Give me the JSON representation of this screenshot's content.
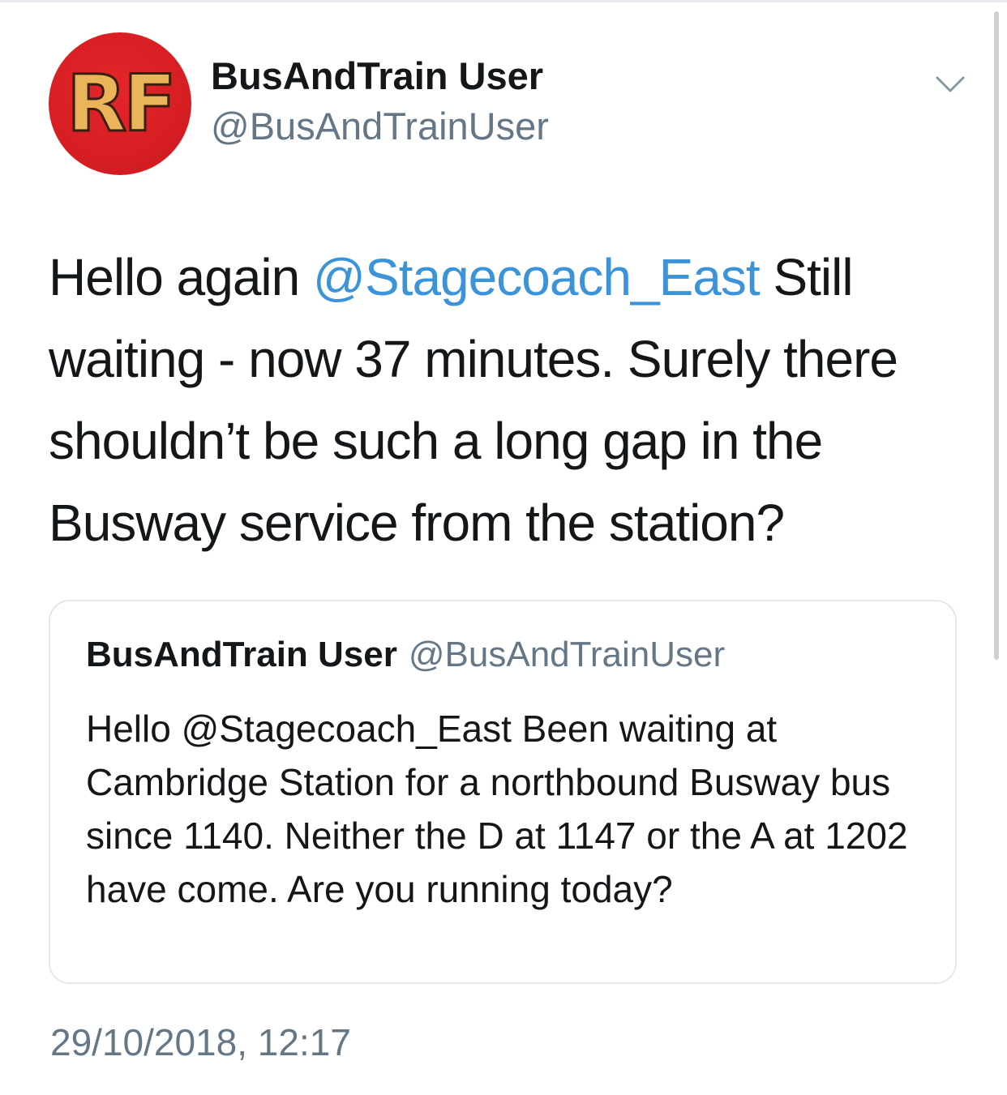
{
  "tweet": {
    "author": {
      "display_name": "BusAndTrain User",
      "handle": "@BusAndTrainUser",
      "avatar_monogram": "RF",
      "avatar_color": "#d41d22"
    },
    "menu_icon": "chevron-down-icon",
    "text_before": "Hello again ",
    "mention": "@Stagecoach_East",
    "text_after": " Still waiting - now 37 minutes. Surely there shouldn’t be such a long gap in the Busway service from the station?",
    "mention_color": "#3b94d9",
    "quoted": {
      "display_name": "BusAndTrain User",
      "handle": "@BusAndTrainUser",
      "text": "Hello @Stagecoach_East Been waiting at Cambridge Station for a northbound Busway bus since 1140. Neither the D at 1147 or the A at 1202 have come. Are you running today?"
    },
    "timestamp": "29/10/2018, 12:17"
  }
}
